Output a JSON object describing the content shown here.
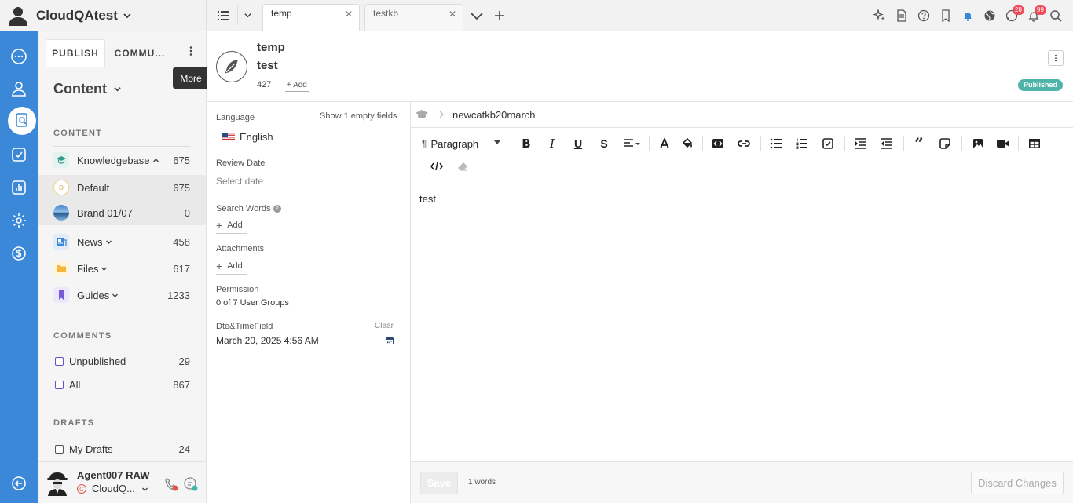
{
  "brand": {
    "name": "CloudQAtest"
  },
  "tabs": [
    {
      "label": "temp"
    },
    {
      "label": "testkb"
    }
  ],
  "top_badges": {
    "chat": "28",
    "bell": "99"
  },
  "tooltip": {
    "more": "More"
  },
  "nav": {
    "tabs": [
      "PUBLISH",
      "COMMU..."
    ],
    "content_dropdown": "Content",
    "content_section": "CONTENT",
    "content_items": [
      {
        "label": "Knowledgebase",
        "count": "675"
      },
      {
        "label": "Default",
        "count": "675"
      },
      {
        "label": "Brand 01/07",
        "count": "0"
      },
      {
        "label": "News",
        "count": "458"
      },
      {
        "label": "Files",
        "count": "617"
      },
      {
        "label": "Guides",
        "count": "1233"
      }
    ],
    "comments_section": "COMMENTS",
    "comment_items": [
      {
        "label": "Unpublished",
        "count": "29"
      },
      {
        "label": "All",
        "count": "867"
      }
    ],
    "drafts_section": "DRAFTS",
    "draft_items": [
      {
        "label": "My Drafts",
        "count": "24"
      }
    ],
    "default_badge": "D"
  },
  "user": {
    "name": "Agent007 RAW",
    "org": "CloudQ..."
  },
  "doc": {
    "title": "temp",
    "subtitle": "test",
    "id": "427",
    "add_label": "+ Add",
    "status": "Published"
  },
  "props": {
    "language_label": "Language",
    "show_empty": "Show 1 empty fields",
    "language_value": "English",
    "review_label": "Review Date",
    "review_placeholder": "Select date",
    "search_words_label": "Search Words",
    "add": "Add",
    "attachments_label": "Attachments",
    "permission_label": "Permission",
    "permission_value": "0 of 7 User Groups",
    "datetime_label": "Dte&TimeField",
    "clear": "Clear",
    "datetime_value": "March 20, 2025 4:56 AM"
  },
  "editor": {
    "breadcrumb": "newcatkb20march",
    "block_style": "Paragraph",
    "body": "test"
  },
  "footer": {
    "save": "Save",
    "words": "1 words",
    "discard": "Discard Changes"
  },
  "colors": {
    "rail": "#3b87d8",
    "published": "#4fb3a9",
    "badge": "#f04b5a"
  }
}
